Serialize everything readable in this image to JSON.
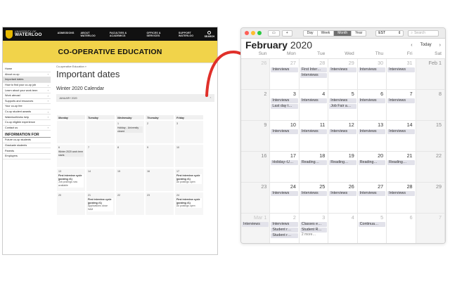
{
  "web": {
    "logo": {
      "line1": "UNIVERSITY OF",
      "line2": "WATERLOO"
    },
    "nav": [
      "ADMISSIONS",
      "ABOUT WATERLOO",
      "FACULTIES & ACADEMICS",
      "OFFICES & SERVICES",
      "SUPPORT WATERLOO"
    ],
    "search_label": "SEARCH",
    "banner": "CO-OPERATIVE EDUCATION",
    "sidebar": [
      {
        "label": "Home",
        "chev": false,
        "active": false
      },
      {
        "label": "About co-op",
        "chev": true,
        "active": false
      },
      {
        "label": "Important dates",
        "chev": false,
        "active": true
      },
      {
        "label": "How to find your co-op job",
        "chev": true,
        "active": false
      },
      {
        "label": "Learn about your work term",
        "chev": true,
        "active": false
      },
      {
        "label": "Work abroad",
        "chev": true,
        "active": false
      },
      {
        "label": "Supports and resources",
        "chev": true,
        "active": false
      },
      {
        "label": "Your co-op fee",
        "chev": false,
        "active": false
      },
      {
        "label": "Co-op student awards",
        "chev": true,
        "active": false
      },
      {
        "label": "WaterlooWorks help",
        "chev": true,
        "active": false
      },
      {
        "label": "Co-op eligible experience",
        "chev": false,
        "active": false
      },
      {
        "label": "Contact us",
        "chev": true,
        "active": false
      }
    ],
    "info_heading": "INFORMATION FOR",
    "info_links": [
      "Future co-op students",
      "Graduate students",
      "Parents",
      "Employers"
    ],
    "breadcrumb": "Co-operative Education »",
    "page_title": "Important dates",
    "calendar_title": "Winter 2020 Calendar",
    "accordion_label": "JANUARY 2020",
    "weekdays": [
      "Monday",
      "Tuesday",
      "Wednesday",
      "Thursday",
      "Friday"
    ],
    "weeks": [
      [
        {
          "n": "",
          "events": []
        },
        {
          "n": "",
          "events": []
        },
        {
          "n": "1",
          "events": [
            {
              "text": "Holiday - University closed",
              "bold": false,
              "sub": ""
            }
          ]
        },
        {
          "n": "2",
          "events": []
        },
        {
          "n": "3",
          "events": []
        }
      ],
      [
        {
          "n": "6",
          "events": [
            {
              "text": "Winter 2020 work term starts",
              "bold": false,
              "sub": ""
            }
          ]
        },
        {
          "n": "7",
          "events": []
        },
        {
          "n": "8",
          "events": []
        },
        {
          "n": "9",
          "events": []
        },
        {
          "n": "10",
          "events": []
        }
      ],
      [
        {
          "n": "13",
          "events": [
            {
              "text": "First interview cycle (posting #1)",
              "bold": true,
              "sub": "Job postings now available"
            }
          ]
        },
        {
          "n": "14",
          "events": []
        },
        {
          "n": "15",
          "events": []
        },
        {
          "n": "16",
          "events": []
        },
        {
          "n": "17",
          "events": [
            {
              "text": "First interview cycle (posting #1)",
              "bold": true,
              "sub": "All postings open"
            }
          ]
        }
      ],
      [
        {
          "n": "20",
          "events": []
        },
        {
          "n": "21",
          "events": [
            {
              "text": "First interview cycle (posting #1)",
              "bold": true,
              "sub": "Applications close 9AM"
            }
          ]
        },
        {
          "n": "22",
          "events": []
        },
        {
          "n": "23",
          "events": []
        },
        {
          "n": "24",
          "events": [
            {
              "text": "First interview cycle (posting #1)",
              "bold": true,
              "sub": "All postings open"
            }
          ]
        }
      ]
    ]
  },
  "calendar": {
    "toolbar": {
      "add": "+",
      "views": [
        "Day",
        "Week",
        "Month",
        "Year"
      ],
      "active_view": "Month",
      "timezone": "EST",
      "search_placeholder": "Search"
    },
    "month": "February",
    "year": "2020",
    "today": "Today",
    "prev": "‹",
    "next": "›",
    "dow": [
      "Sun",
      "Mon",
      "Tue",
      "Wed",
      "Thu",
      "Fri",
      "Sat"
    ],
    "weeks": [
      [
        {
          "n": "26",
          "other": true,
          "events": []
        },
        {
          "n": "27",
          "other": true,
          "events": [
            "Interviews"
          ]
        },
        {
          "n": "28",
          "other": true,
          "events": [
            "First Inter…",
            "Interviews"
          ]
        },
        {
          "n": "29",
          "other": true,
          "events": [
            "Interviews"
          ]
        },
        {
          "n": "30",
          "other": true,
          "events": [
            "Interviews"
          ]
        },
        {
          "n": "31",
          "other": true,
          "events": [
            "Interviews"
          ]
        },
        {
          "n": "Feb 1",
          "other": false,
          "events": []
        }
      ],
      [
        {
          "n": "2",
          "other": false,
          "events": []
        },
        {
          "n": "3",
          "other": false,
          "events": [
            "Interviews",
            "Last day t…"
          ]
        },
        {
          "n": "4",
          "other": false,
          "events": [
            "Interviews"
          ]
        },
        {
          "n": "5",
          "other": false,
          "events": [
            "Interviews",
            "Job Fair a…"
          ]
        },
        {
          "n": "6",
          "other": false,
          "events": [
            "Interviews"
          ]
        },
        {
          "n": "7",
          "other": false,
          "events": [
            "Interviews"
          ]
        },
        {
          "n": "8",
          "other": false,
          "events": []
        }
      ],
      [
        {
          "n": "9",
          "other": false,
          "events": []
        },
        {
          "n": "10",
          "other": false,
          "events": [
            "Interviews"
          ]
        },
        {
          "n": "11",
          "other": false,
          "events": [
            "Interviews"
          ]
        },
        {
          "n": "12",
          "other": false,
          "events": [
            "Interviews"
          ]
        },
        {
          "n": "13",
          "other": false,
          "events": [
            "Interviews"
          ]
        },
        {
          "n": "14",
          "other": false,
          "events": [
            "Interviews"
          ]
        },
        {
          "n": "15",
          "other": false,
          "events": []
        }
      ],
      [
        {
          "n": "16",
          "other": false,
          "events": []
        },
        {
          "n": "17",
          "other": false,
          "events": [
            "Holiday–U…"
          ]
        },
        {
          "n": "18",
          "other": false,
          "events": [
            "Reading…"
          ]
        },
        {
          "n": "19",
          "other": false,
          "events": [
            "Reading…"
          ]
        },
        {
          "n": "20",
          "other": false,
          "events": [
            "Reading…"
          ]
        },
        {
          "n": "21",
          "other": false,
          "events": [
            "Reading…"
          ]
        },
        {
          "n": "22",
          "other": false,
          "events": []
        }
      ],
      [
        {
          "n": "23",
          "other": false,
          "events": []
        },
        {
          "n": "24",
          "other": false,
          "events": [
            "Interviews"
          ]
        },
        {
          "n": "25",
          "other": false,
          "events": [
            "Interviews"
          ]
        },
        {
          "n": "26",
          "other": false,
          "events": [
            "Interviews"
          ]
        },
        {
          "n": "27",
          "other": false,
          "events": [
            "Interviews"
          ]
        },
        {
          "n": "28",
          "other": false,
          "events": [
            "Interviews"
          ]
        },
        {
          "n": "29",
          "other": false,
          "events": []
        }
      ],
      [
        {
          "n": "Mar 1",
          "other": true,
          "events": [
            "Interviews"
          ]
        },
        {
          "n": "2",
          "other": true,
          "events": [
            "Interviews",
            "Student r…",
            "Student r…"
          ]
        },
        {
          "n": "3",
          "other": true,
          "events": [
            "Classes e…",
            "Student R…"
          ],
          "more": "2 more…"
        },
        {
          "n": "4",
          "other": true,
          "events": []
        },
        {
          "n": "5",
          "other": true,
          "events": [
            "Continua…"
          ]
        },
        {
          "n": "6",
          "other": true,
          "events": []
        },
        {
          "n": "7",
          "other": true,
          "events": []
        }
      ]
    ]
  },
  "colors": {
    "nav_bg": "#111111",
    "banner": "#f1d34a",
    "arrow": "#e0302a",
    "selected_view": "#6e6e6e",
    "event_bg": "#e2e2ea"
  }
}
